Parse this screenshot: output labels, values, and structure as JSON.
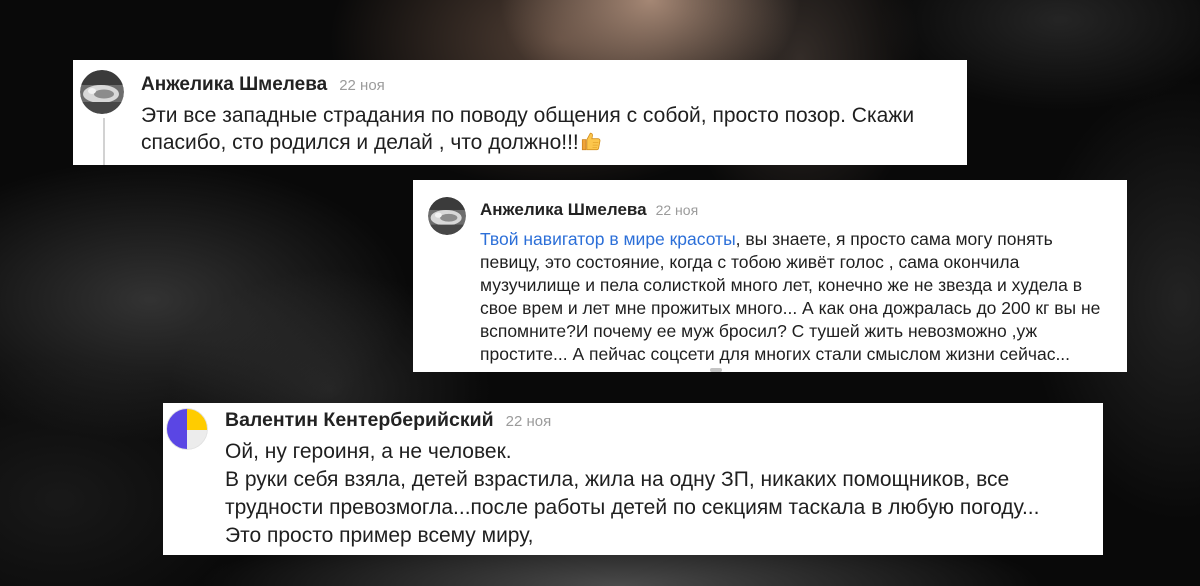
{
  "colors": {
    "link": "#2c6fd8",
    "date": "#9b9b9b",
    "text": "#1f1f1f",
    "author": "#222222",
    "card": "#ffffff"
  },
  "comments": [
    {
      "author": "Анжелика Шмелева",
      "date": "22 ноя",
      "avatar": "profile-photo-avatar",
      "lines": [
        "Эти все западные страдания по поводу общения с собой, просто позор. Скажи",
        "спасибо, сто родился и делай , что должно!!!"
      ],
      "trailing_icon": "thumbs-up-icon"
    },
    {
      "author": "Анжелика Шмелева",
      "date": "22 ноя",
      "avatar": "profile-photo-avatar",
      "link_text": "Твой навигатор в мире красоты",
      "lines": [
        ", вы знаете, я просто сама могу понять",
        "певицу, это состояние, когда с тобою живёт голос , сама окончила",
        "музучилище и пела солисткой много лет, конечно же не звезда и худела в",
        "свое врем и лет мне прожитых много... А как она дожралась до 200 кг вы не",
        "вспомните?И почему ее муж бросил? С тушей жить невозможно ,уж",
        "простите... А пейчас соцсети для многих стали смыслом жизни сейчас..."
      ]
    },
    {
      "author": "Валентин Кентерберийский",
      "date": "22 ноя",
      "avatar": "default-avatar",
      "lines": [
        "Ой, ну героиня, а не человек.",
        "В руки себя взяла, детей взрастила, жила на одну ЗП, никаких помощников, все",
        "трудности превозмогла...после работы детей по секциям таскала в любую погоду...",
        "Это просто пример всему миру,"
      ]
    }
  ]
}
